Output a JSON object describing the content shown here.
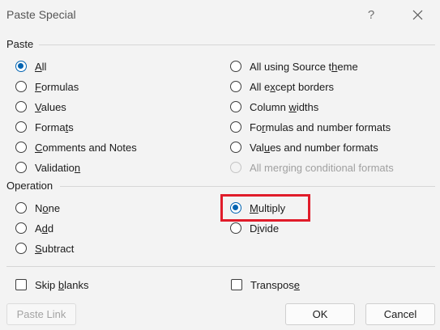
{
  "dialog": {
    "title": "Paste Special",
    "help": "?"
  },
  "paste": {
    "label": "Paste",
    "left": [
      {
        "pre": "",
        "key": "A",
        "post": "ll",
        "checked": true
      },
      {
        "pre": "",
        "key": "F",
        "post": "ormulas"
      },
      {
        "pre": "",
        "key": "V",
        "post": "alues"
      },
      {
        "pre": "Forma",
        "key": "t",
        "post": "s"
      },
      {
        "pre": "",
        "key": "C",
        "post": "omments and Notes"
      },
      {
        "pre": "Validatio",
        "key": "n",
        "post": ""
      }
    ],
    "right": [
      {
        "pre": "All using Source t",
        "key": "h",
        "post": "eme"
      },
      {
        "pre": "All e",
        "key": "x",
        "post": "cept borders"
      },
      {
        "pre": "Column ",
        "key": "w",
        "post": "idths"
      },
      {
        "pre": "Fo",
        "key": "r",
        "post": "mulas and number formats"
      },
      {
        "pre": "Val",
        "key": "u",
        "post": "es and number formats"
      },
      {
        "pre": "All mer",
        "key": "g",
        "post": "ing conditional formats",
        "disabled": true
      }
    ]
  },
  "operation": {
    "label": "Operation",
    "left": [
      {
        "pre": "N",
        "key": "o",
        "post": "ne"
      },
      {
        "pre": "A",
        "key": "d",
        "post": "d"
      },
      {
        "pre": "",
        "key": "S",
        "post": "ubtract"
      }
    ],
    "right": [
      {
        "pre": "",
        "key": "M",
        "post": "ultiply",
        "checked": true
      },
      {
        "pre": "D",
        "key": "i",
        "post": "vide"
      }
    ]
  },
  "options": {
    "skip_blanks": {
      "pre": "Skip ",
      "key": "b",
      "post": "lanks"
    },
    "transpose": {
      "pre": "Transpos",
      "key": "e",
      "post": ""
    }
  },
  "buttons": {
    "paste_link": "Paste Link",
    "ok": "OK",
    "cancel": "Cancel"
  },
  "colors": {
    "accent": "#0063b1",
    "highlight": "#e01c2a"
  }
}
